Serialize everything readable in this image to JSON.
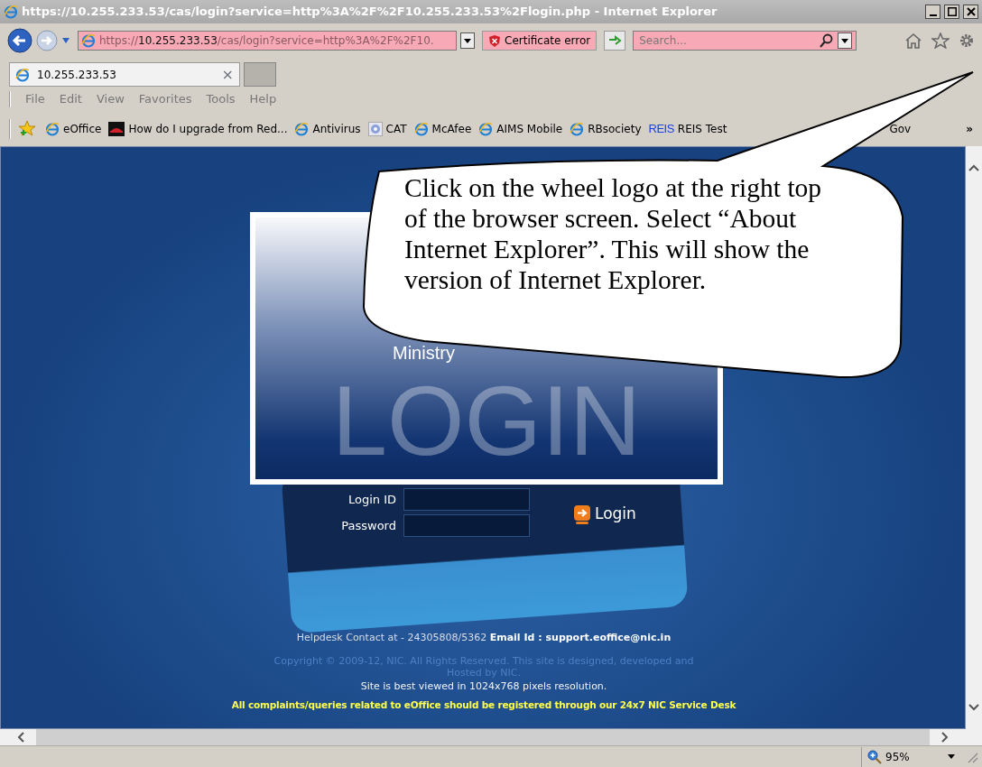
{
  "window": {
    "title": "https://10.255.233.53/cas/login?service=http%3A%2F%2F10.255.233.53%2Flogin.php - Internet Explorer"
  },
  "address_bar": {
    "url": "https://**10.255.233.53**/cas/login?service=http%3A%2F%2F10.",
    "certificate": "Certificate error",
    "search": {
      "placeholder": "Search..."
    }
  },
  "tabs": [
    {
      "label": "10.255.233.53",
      "close": "×",
      "selected": true
    }
  ],
  "menu": [
    "File",
    "Edit",
    "View",
    "Favorites",
    "Tools",
    "Help"
  ],
  "favorites": [
    {
      "label": "eOffice",
      "kind": "ie"
    },
    {
      "label": "How do I upgrade from Red...",
      "kind": "hat"
    },
    {
      "label": "Antivirus",
      "kind": "ie"
    },
    {
      "label": "CAT",
      "kind": "disc"
    },
    {
      "label": "McAfee",
      "kind": "ie"
    },
    {
      "label": "AIMS Mobile",
      "kind": "ie"
    },
    {
      "label": "RBsociety",
      "kind": "ie"
    },
    {
      "label": "REIS Test",
      "kind": "mark",
      "mark": "REIS"
    },
    {
      "label": "Gov",
      "kind": "plain"
    }
  ],
  "favorites_more": "»",
  "page": {
    "ministry": "Ministry",
    "watermark": "LOGIN",
    "fields": [
      {
        "label": "Login ID"
      },
      {
        "label": "Password"
      }
    ],
    "login_button": "Login",
    "helpdesk": "Helpdesk Contact at - 24305808/5362",
    "email": "Email Id : support.eoffice@nic.in",
    "copyright": "Copyright © 2009-12, NIC. All Rights Reserved. This site is designed, developed and Hosted by NIC.",
    "resolution": "Site is best viewed in 1024x768 pixels resolution.",
    "complaints": "All complaints/queries related to eOffice should be registered through our 24x7 NIC Service Desk"
  },
  "status_bar": {
    "zoom": "95%"
  },
  "callout": {
    "text": "Click on the wheel logo at the right top of the browser screen. Select “About Internet Explorer”. This will show the version of Internet Explorer."
  }
}
